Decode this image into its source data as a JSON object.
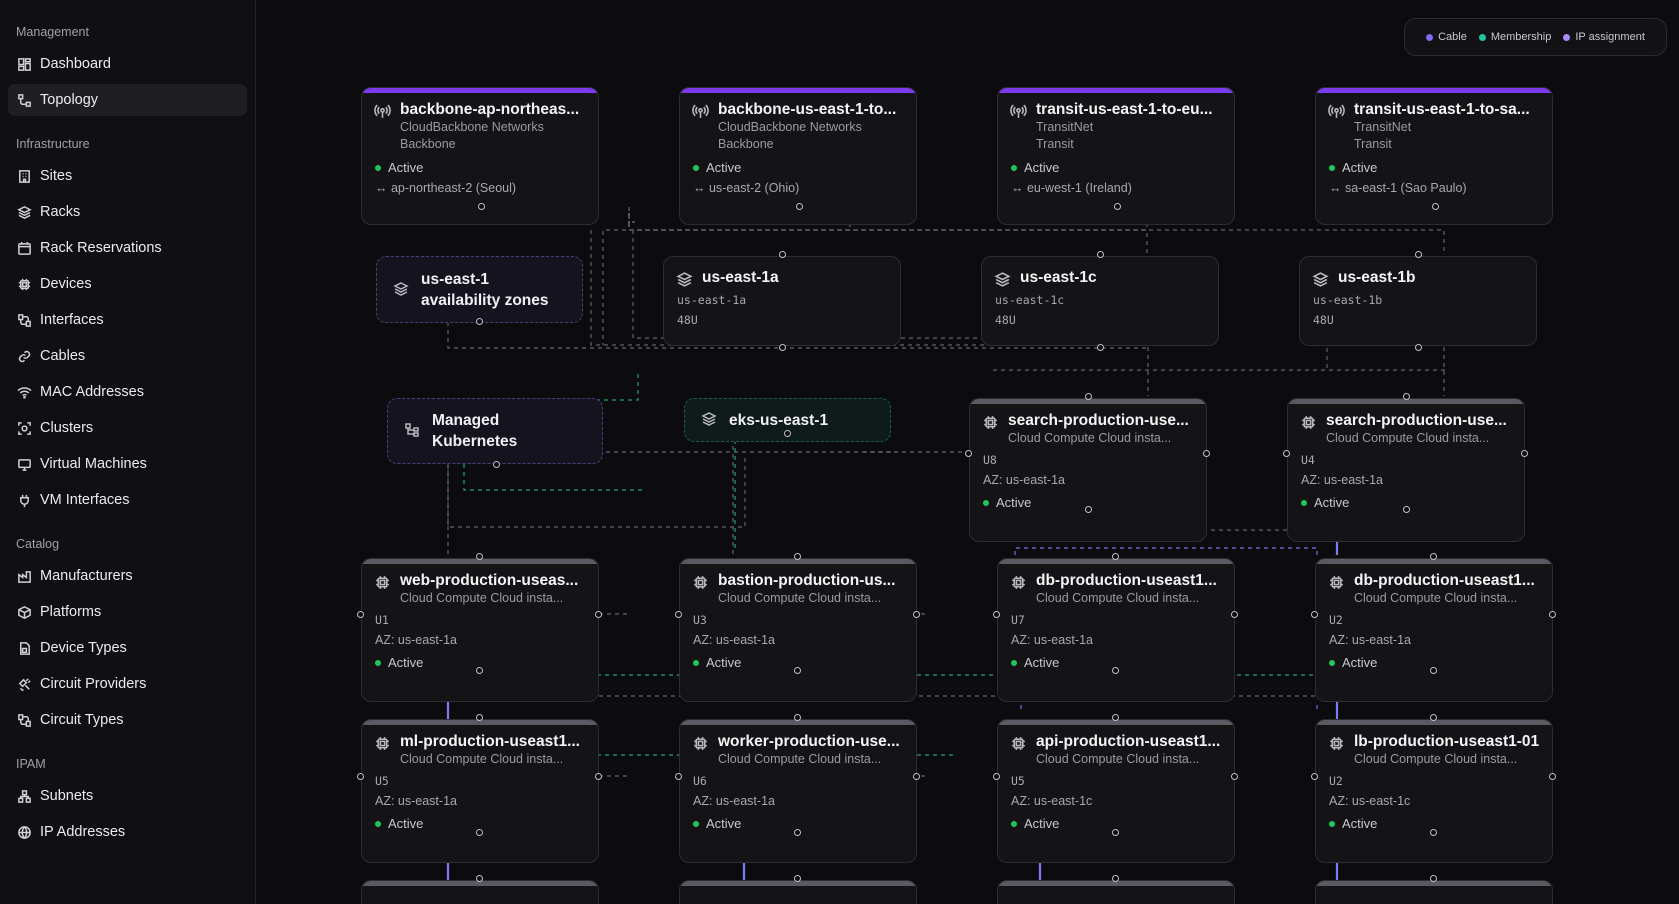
{
  "sidebar": {
    "sections": [
      {
        "title": "Management",
        "items": [
          {
            "label": "Dashboard",
            "icon": "dashboard-icon"
          },
          {
            "label": "Topology",
            "icon": "topology-icon",
            "active": true
          }
        ]
      },
      {
        "title": "Infrastructure",
        "items": [
          {
            "label": "Sites",
            "icon": "building-icon"
          },
          {
            "label": "Racks",
            "icon": "layers-icon"
          },
          {
            "label": "Rack Reservations",
            "icon": "calendar-icon"
          },
          {
            "label": "Devices",
            "icon": "chip-icon"
          },
          {
            "label": "Interfaces",
            "icon": "plug-icon"
          },
          {
            "label": "Cables",
            "icon": "link-icon"
          },
          {
            "label": "MAC Addresses",
            "icon": "wifi-icon"
          },
          {
            "label": "Clusters",
            "icon": "cluster-icon"
          },
          {
            "label": "Virtual Machines",
            "icon": "monitor-icon"
          },
          {
            "label": "VM Interfaces",
            "icon": "connector-icon"
          }
        ]
      },
      {
        "title": "Catalog",
        "items": [
          {
            "label": "Manufacturers",
            "icon": "factory-icon"
          },
          {
            "label": "Platforms",
            "icon": "box-icon"
          },
          {
            "label": "Device Types",
            "icon": "file-chip-icon"
          },
          {
            "label": "Circuit Providers",
            "icon": "satellite-icon"
          },
          {
            "label": "Circuit Types",
            "icon": "plug-icon"
          }
        ]
      },
      {
        "title": "IPAM",
        "items": [
          {
            "label": "Subnets",
            "icon": "network-icon"
          },
          {
            "label": "IP Addresses",
            "icon": "globe-icon"
          }
        ]
      }
    ]
  },
  "legend": [
    {
      "label": "Cable",
      "color": "#7c6cf2"
    },
    {
      "label": "Membership",
      "color": "#22c5a0"
    },
    {
      "label": "IP assignment",
      "color": "#a78bfa"
    }
  ],
  "circuits": [
    {
      "title": "backbone-ap-northeas...",
      "provider": "CloudBackbone Networks",
      "type": "Backbone",
      "status": "Active",
      "region": "↔ ap-northeast-2 (Seoul)"
    },
    {
      "title": "backbone-us-east-1-to...",
      "provider": "CloudBackbone Networks",
      "type": "Backbone",
      "status": "Active",
      "region": "↔ us-east-2 (Ohio)"
    },
    {
      "title": "transit-us-east-1-to-eu...",
      "provider": "TransitNet",
      "type": "Transit",
      "status": "Active",
      "region": "↔ eu-west-1 (Ireland)"
    },
    {
      "title": "transit-us-east-1-to-sa...",
      "provider": "TransitNet",
      "type": "Transit",
      "status": "Active",
      "region": "↔ sa-east-1 (Sao Paulo)"
    }
  ],
  "groups": {
    "az": "us-east-1 availability zones",
    "k8s": "Managed Kubernetes",
    "eks": "eks-us-east-1"
  },
  "racks": [
    {
      "title": "us-east-1a",
      "code": "us-east-1a",
      "size": "48U"
    },
    {
      "title": "us-east-1c",
      "code": "us-east-1c",
      "size": "48U"
    },
    {
      "title": "us-east-1b",
      "code": "us-east-1b",
      "size": "48U"
    }
  ],
  "devices": [
    {
      "title": "search-production-use...",
      "sub": "Cloud Compute Cloud insta...",
      "unit": "U8",
      "az": "AZ: us-east-1a",
      "status": "Active"
    },
    {
      "title": "search-production-use...",
      "sub": "Cloud Compute Cloud insta...",
      "unit": "U4",
      "az": "AZ: us-east-1a",
      "status": "Active"
    },
    {
      "title": "web-production-useas...",
      "sub": "Cloud Compute Cloud insta...",
      "unit": "U1",
      "az": "AZ: us-east-1a",
      "status": "Active"
    },
    {
      "title": "bastion-production-us...",
      "sub": "Cloud Compute Cloud insta...",
      "unit": "U3",
      "az": "AZ: us-east-1a",
      "status": "Active"
    },
    {
      "title": "db-production-useast1...",
      "sub": "Cloud Compute Cloud insta...",
      "unit": "U7",
      "az": "AZ: us-east-1a",
      "status": "Active"
    },
    {
      "title": "db-production-useast1...",
      "sub": "Cloud Compute Cloud insta...",
      "unit": "U2",
      "az": "AZ: us-east-1a",
      "status": "Active"
    },
    {
      "title": "ml-production-useast1...",
      "sub": "Cloud Compute Cloud insta...",
      "unit": "U5",
      "az": "AZ: us-east-1a",
      "status": "Active"
    },
    {
      "title": "worker-production-use...",
      "sub": "Cloud Compute Cloud insta...",
      "unit": "U6",
      "az": "AZ: us-east-1a",
      "status": "Active"
    },
    {
      "title": "api-production-useast1...",
      "sub": "Cloud Compute Cloud insta...",
      "unit": "U5",
      "az": "AZ: us-east-1c",
      "status": "Active"
    },
    {
      "title": "lb-production-useast1-01",
      "sub": "Cloud Compute Cloud insta...",
      "unit": "U2",
      "az": "AZ: us-east-1c",
      "status": "Active"
    }
  ]
}
